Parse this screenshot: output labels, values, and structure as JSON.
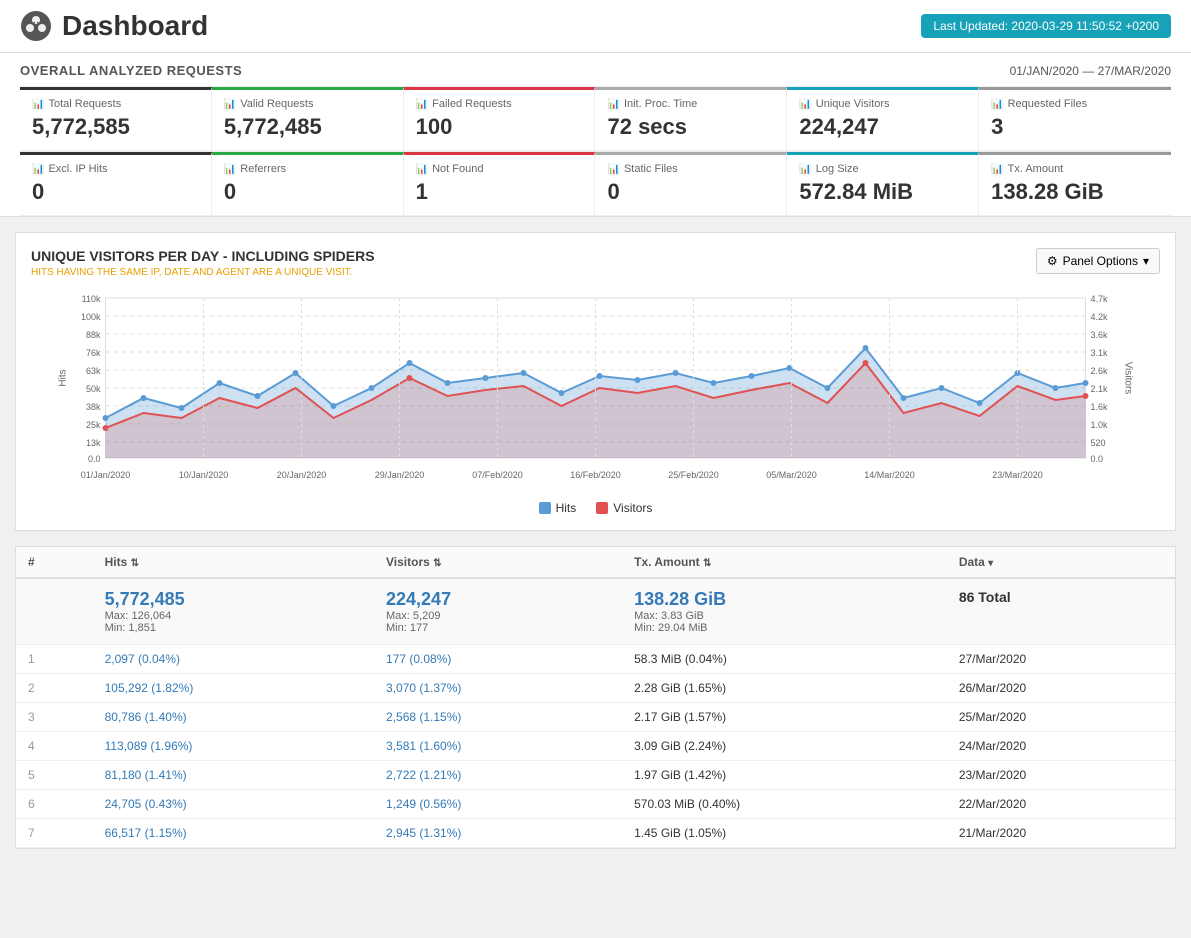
{
  "header": {
    "title": "Dashboard",
    "last_updated_label": "Last Updated: 2020-03-29 11:50:52 +0200"
  },
  "overall": {
    "title": "OVERALL ANALYZED REQUESTS",
    "date_range": "01/JAN/2020 — 27/MAR/2020"
  },
  "stats_row1": [
    {
      "label": "Total Requests",
      "value": "5,772,585",
      "color": "black"
    },
    {
      "label": "Valid Requests",
      "value": "5,772,485",
      "color": "green"
    },
    {
      "label": "Failed Requests",
      "value": "100",
      "color": "red"
    },
    {
      "label": "Init. Proc. Time",
      "value": "72 secs",
      "color": "gray"
    },
    {
      "label": "Unique Visitors",
      "value": "224,247",
      "color": "cyan"
    },
    {
      "label": "Requested Files",
      "value": "3",
      "color": "gray2"
    }
  ],
  "stats_row2": [
    {
      "label": "Excl. IP Hits",
      "value": "0",
      "color": "black"
    },
    {
      "label": "Referrers",
      "value": "0",
      "color": "green"
    },
    {
      "label": "Not Found",
      "value": "1",
      "color": "red"
    },
    {
      "label": "Static Files",
      "value": "0",
      "color": "gray"
    },
    {
      "label": "Log Size",
      "value": "572.84 MiB",
      "color": "cyan"
    },
    {
      "label": "Tx. Amount",
      "value": "138.28 GiB",
      "color": "gray2"
    }
  ],
  "chart": {
    "title": "UNIQUE VISITORS PER DAY - INCLUDING SPIDERS",
    "subtitle": "HITS HAVING THE SAME IP, DATE AND AGENT ARE A UNIQUE VISIT.",
    "panel_options_label": "Panel Options",
    "x_labels": [
      "01/Jan/2020",
      "10/Jan/2020",
      "20/Jan/2020",
      "29/Jan/2020",
      "07/Feb/2020",
      "16/Feb/2020",
      "25/Feb/2020",
      "05/Mar/2020",
      "14/Mar/2020",
      "23/Mar/2020"
    ],
    "y_left_labels": [
      "110k",
      "100k",
      "88k",
      "76k",
      "63k",
      "50k",
      "38k",
      "25k",
      "13k",
      "0.0"
    ],
    "y_right_labels": [
      "4.7k",
      "4.2k",
      "3.6k",
      "3.1k",
      "2.6k",
      "2.1k",
      "1.6k",
      "1.0k",
      "520",
      "0.0"
    ],
    "left_axis_title": "Hits",
    "right_axis_title": "Visitors",
    "legend": [
      {
        "label": "Hits",
        "color": "#5b9bd5"
      },
      {
        "label": "Visitors",
        "color": "#e05252"
      }
    ]
  },
  "table": {
    "columns": [
      "#",
      "Hits",
      "Visitors",
      "Tx. Amount",
      "Data"
    ],
    "summary": {
      "hits": "5,772,485",
      "hits_max": "Max: 126,064",
      "hits_min": "Min: 1,851",
      "visitors": "224,247",
      "visitors_max": "Max: 5,209",
      "visitors_min": "Min: 177",
      "tx": "138.28 GiB",
      "tx_max": "Max: 3.83 GiB",
      "tx_min": "Min: 29.04 MiB",
      "data": "86 Total"
    },
    "rows": [
      {
        "num": "1",
        "hits": "2,097 (0.04%)",
        "visitors": "177 (0.08%)",
        "tx": "58.3 MiB (0.04%)",
        "date": "27/Mar/2020"
      },
      {
        "num": "2",
        "hits": "105,292 (1.82%)",
        "visitors": "3,070 (1.37%)",
        "tx": "2.28 GiB (1.65%)",
        "date": "26/Mar/2020"
      },
      {
        "num": "3",
        "hits": "80,786 (1.40%)",
        "visitors": "2,568 (1.15%)",
        "tx": "2.17 GiB (1.57%)",
        "date": "25/Mar/2020"
      },
      {
        "num": "4",
        "hits": "113,089 (1.96%)",
        "visitors": "3,581 (1.60%)",
        "tx": "3.09 GiB (2.24%)",
        "date": "24/Mar/2020"
      },
      {
        "num": "5",
        "hits": "81,180 (1.41%)",
        "visitors": "2,722 (1.21%)",
        "tx": "1.97 GiB (1.42%)",
        "date": "23/Mar/2020"
      },
      {
        "num": "6",
        "hits": "24,705 (0.43%)",
        "visitors": "1,249 (0.56%)",
        "tx": "570.03 MiB (0.40%)",
        "date": "22/Mar/2020"
      },
      {
        "num": "7",
        "hits": "66,517 (1.15%)",
        "visitors": "2,945 (1.31%)",
        "tx": "1.45 GiB (1.05%)",
        "date": "21/Mar/2020"
      }
    ]
  }
}
